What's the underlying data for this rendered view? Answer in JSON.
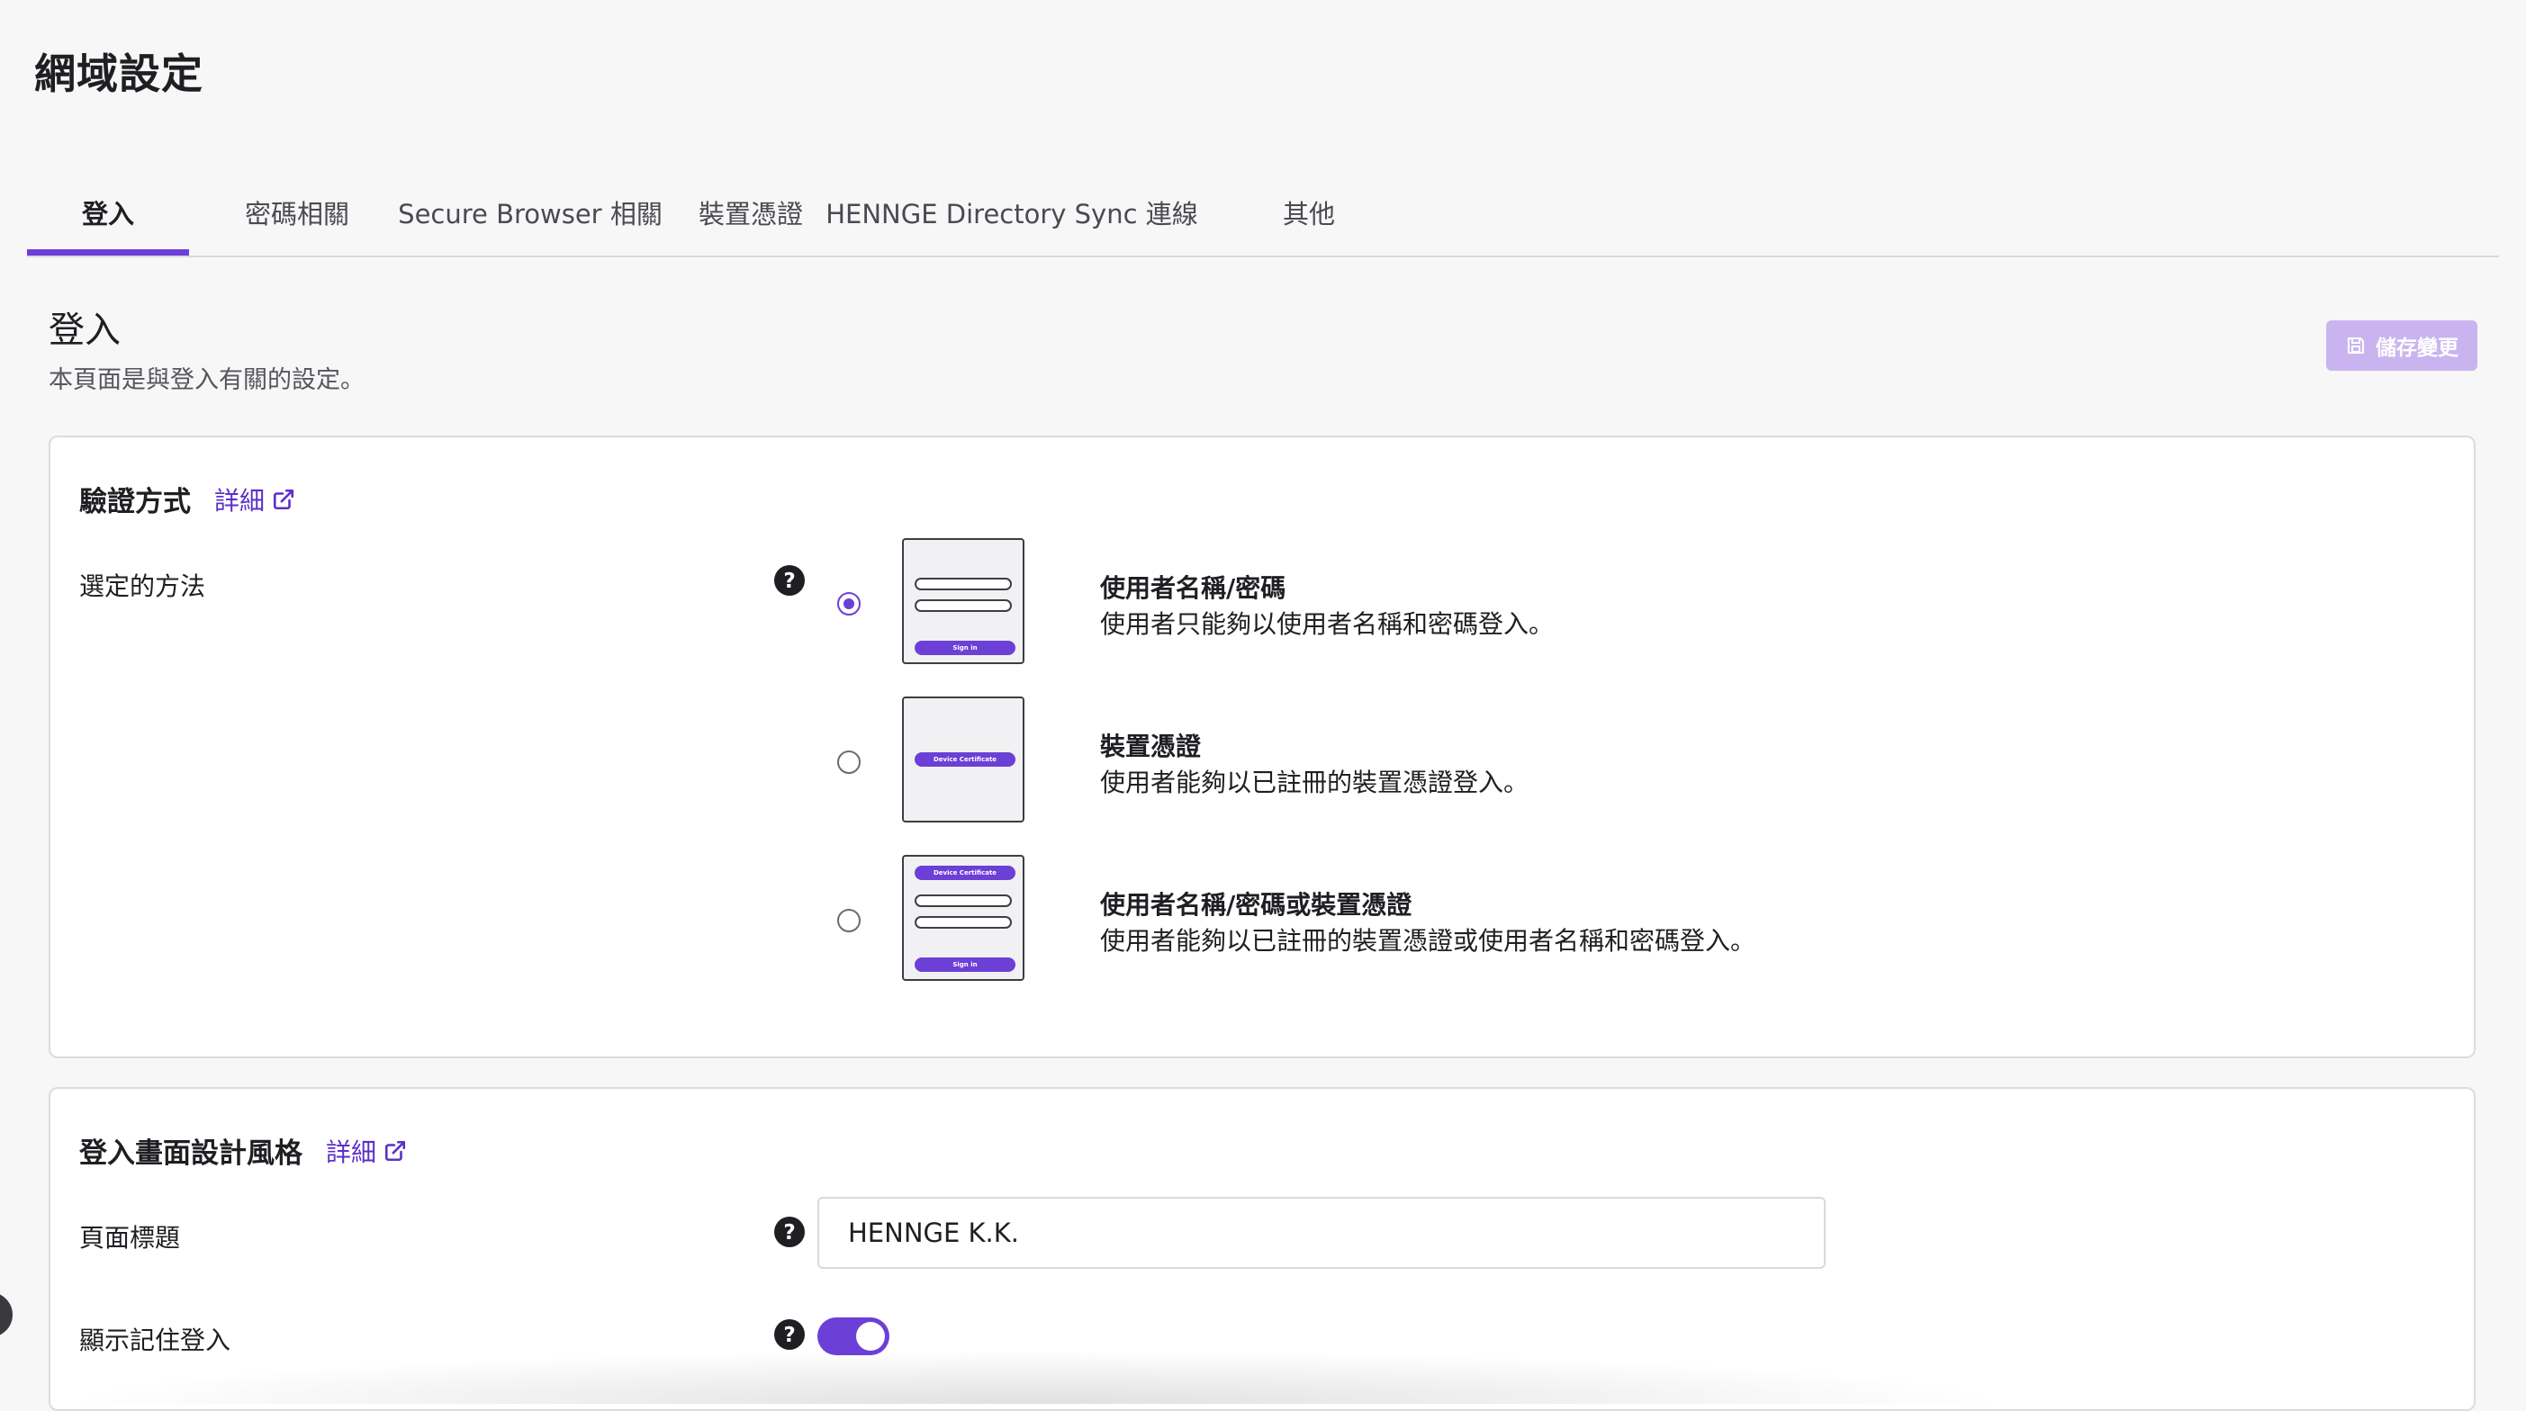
{
  "page": {
    "title": "網域設定"
  },
  "tabs": [
    {
      "label": "登入",
      "active": true
    },
    {
      "label": "密碼相關",
      "active": false
    },
    {
      "label": "Secure Browser 相關",
      "active": false
    },
    {
      "label": "裝置憑證",
      "active": false
    },
    {
      "label": "HENNGE Directory Sync 連線",
      "active": false
    },
    {
      "label": "其他",
      "active": false
    }
  ],
  "section": {
    "title": "登入",
    "description": "本頁面是與登入有關的設定。",
    "save_label": "儲存變更"
  },
  "auth_card": {
    "heading": "驗證方式",
    "detail_link": "詳細",
    "row_label": "選定的方法",
    "options": [
      {
        "title": "使用者名稱/密碼",
        "description": "使用者只能夠以使用者名稱和密碼登入。",
        "selected": true,
        "thumb": {
          "button": "Sign in"
        }
      },
      {
        "title": "裝置憑證",
        "description": "使用者能夠以已註冊的裝置憑證登入。",
        "selected": false,
        "thumb": {
          "button": "Device Certificate"
        }
      },
      {
        "title": "使用者名稱/密碼或裝置憑證",
        "description": "使用者能夠以已註冊的裝置憑證或使用者名稱和密碼登入。",
        "selected": false,
        "thumb": {
          "top_button": "Device Certificate",
          "button": "Sign in"
        }
      }
    ]
  },
  "design_card": {
    "heading": "登入畫面設計風格",
    "detail_link": "詳細",
    "page_title_label": "頁面標題",
    "page_title_value": "HENNGE K.K.",
    "remember_label": "顯示記住登入",
    "remember_enabled": true
  },
  "colors": {
    "accent": "#6c3fd6",
    "save_disabled": "#c9b4ef",
    "background": "#f7f7f8"
  }
}
